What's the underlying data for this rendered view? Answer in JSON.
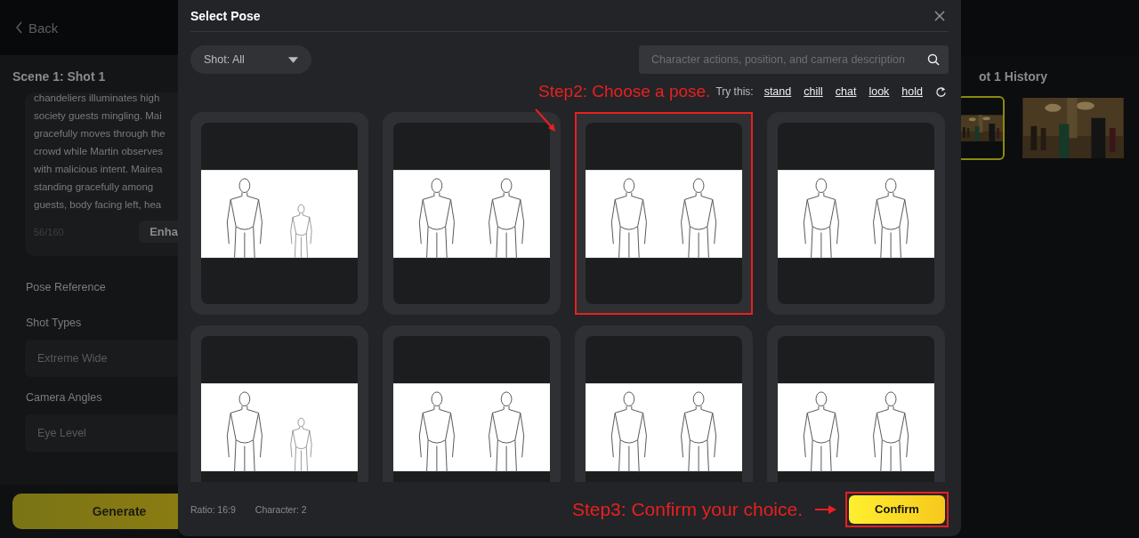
{
  "page": {
    "back": "Back",
    "scene_title": "Scene 1: Shot 1",
    "description_lines": [
      "chandeliers illuminates high",
      "society guests mingling. Mai",
      "gracefully moves through the",
      "crowd while Martin observes",
      "with malicious intent. Mairea",
      "standing gracefully among",
      "guests, body facing left, hea"
    ],
    "char_count": "56/160",
    "enhance_button": "Enha",
    "sections": [
      {
        "kind": "label",
        "text": "Pose Reference"
      },
      {
        "kind": "label",
        "text": "Shot Types"
      },
      {
        "kind": "field",
        "text": "Extreme Wide"
      },
      {
        "kind": "label",
        "text": "Camera Angles"
      },
      {
        "kind": "field",
        "text": "Eye Level"
      }
    ],
    "generate_button": "Generate",
    "history_title": "ot 1 History",
    "history": [
      {
        "kind": "picture",
        "selected": true
      },
      {
        "kind": "picture",
        "selected": false
      }
    ]
  },
  "dialog": {
    "title": "Select Pose",
    "shot_filter": "Shot: All",
    "search": {
      "placeholder": "Character actions, position, and camera description"
    },
    "try_label": "Try this:",
    "suggestions": [
      "stand",
      "chill",
      "chat",
      "look",
      "hold"
    ],
    "poses": [
      {
        "selected": false
      },
      {
        "selected": false
      },
      {
        "selected": true
      },
      {
        "selected": false
      },
      {
        "selected": false
      },
      {
        "selected": false
      },
      {
        "selected": false
      },
      {
        "selected": false
      }
    ],
    "ratio": "Ratio: 16:9",
    "character": "Character: 2",
    "confirm_button": "Confirm"
  },
  "annotations": [
    {
      "text": "Step2: Choose a pose."
    },
    {
      "text": "Step3: Confirm your choice."
    }
  ]
}
